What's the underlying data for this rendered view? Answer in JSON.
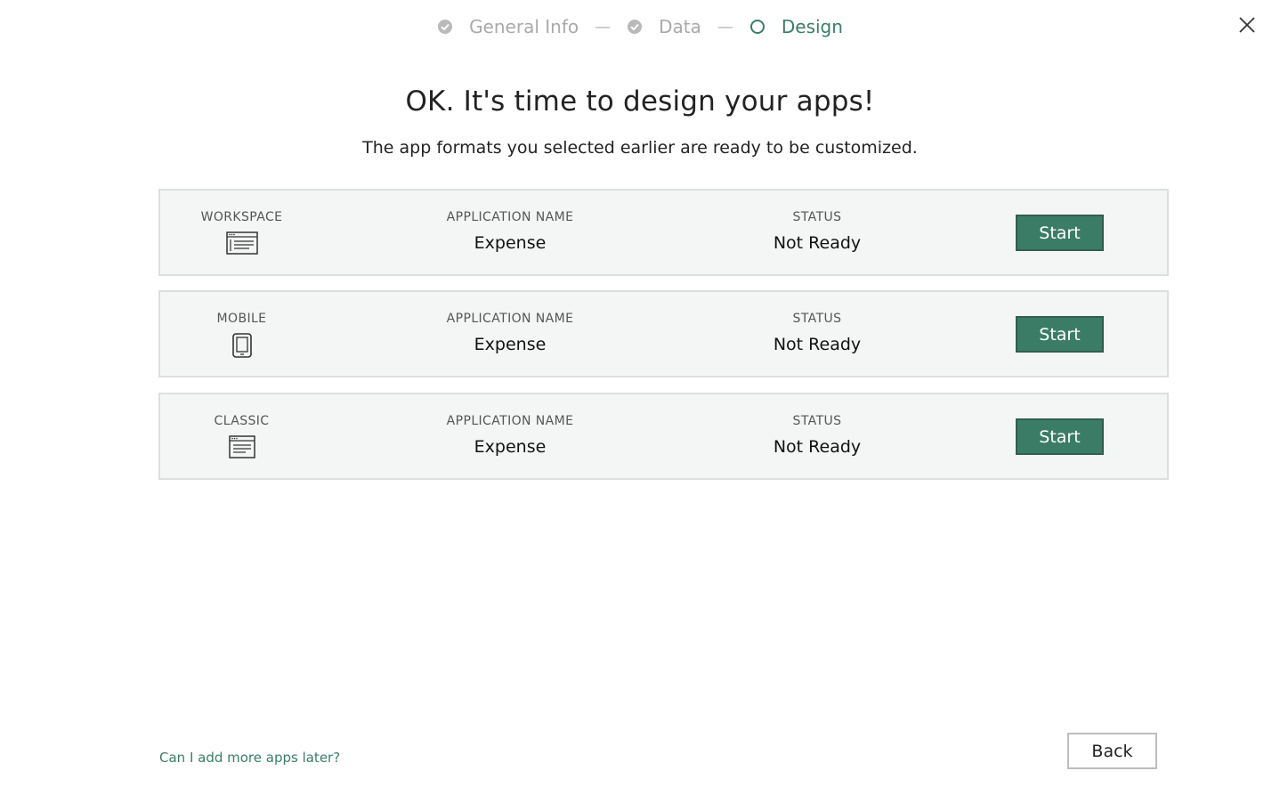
{
  "stepper": {
    "steps": [
      {
        "label": "General Info",
        "state": "done"
      },
      {
        "label": "Data",
        "state": "done"
      },
      {
        "label": "Design",
        "state": "active"
      }
    ],
    "separator": "—"
  },
  "headline": "OK. It's time to design your apps!",
  "subline": "The app formats you selected earlier are ready to be customized.",
  "columns": {
    "app_name_label": "APPLICATION NAME",
    "status_label": "STATUS"
  },
  "apps": [
    {
      "format": "WORKSPACE",
      "icon": "workspace-window-icon",
      "name": "Expense",
      "status": "Not Ready",
      "button": "Start"
    },
    {
      "format": "MOBILE",
      "icon": "mobile-phone-icon",
      "name": "Expense",
      "status": "Not Ready",
      "button": "Start"
    },
    {
      "format": "CLASSIC",
      "icon": "classic-window-icon",
      "name": "Expense",
      "status": "Not Ready",
      "button": "Start"
    }
  ],
  "footer": {
    "help_link": "Can I add more apps later?",
    "back_label": "Back"
  },
  "colors": {
    "accent": "#3b7c67",
    "card_bg": "#f4f6f5"
  }
}
